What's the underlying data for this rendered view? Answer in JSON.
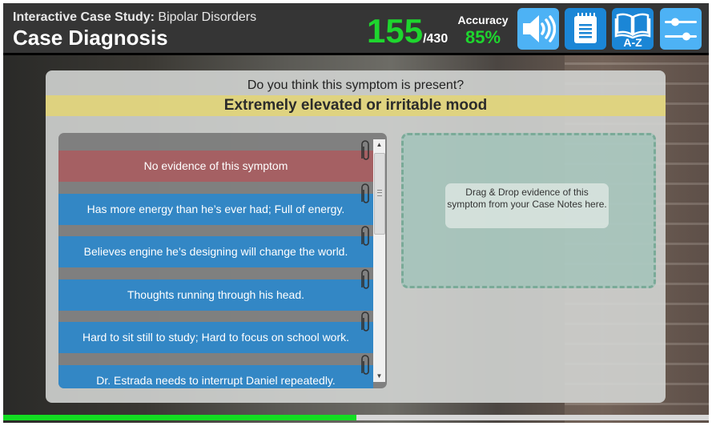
{
  "header": {
    "subtitle_bold": "Interactive Case Study:",
    "subtitle_rest": " Bipolar Disorders",
    "title": "Case Diagnosis",
    "score": "155",
    "score_total": "/430",
    "accuracy_label": "Accuracy",
    "accuracy_value": "85%",
    "icons": [
      "speaker-icon",
      "notepad-icon",
      "glossary-book-az-icon",
      "settings-sliders-icon"
    ],
    "colors": {
      "score": "#1ed62e",
      "icon_light": "#4db2f5",
      "icon_dark": "#1b86d6"
    }
  },
  "main": {
    "question": "Do you think this symptom is present?",
    "symptom": "Extremely elevated or irritable mood",
    "evidence_items": [
      {
        "text": "No evidence of this symptom",
        "kind": "none"
      },
      {
        "text": "Has more energy than he’s ever had; Full of energy.",
        "kind": "evidence"
      },
      {
        "text": "Believes engine he’s designing will change the world.",
        "kind": "evidence"
      },
      {
        "text": "Thoughts running through his head.",
        "kind": "evidence"
      },
      {
        "text": "Hard to sit still to study; Hard to focus on school work.",
        "kind": "evidence"
      },
      {
        "text": "Dr. Estrada needs to interrupt Daniel repeatedly.",
        "kind": "evidence"
      }
    ],
    "drop_zone_text": "Drag & Drop evidence of this symptom from your Case Notes here."
  },
  "progress": {
    "fraction": 0.5
  }
}
